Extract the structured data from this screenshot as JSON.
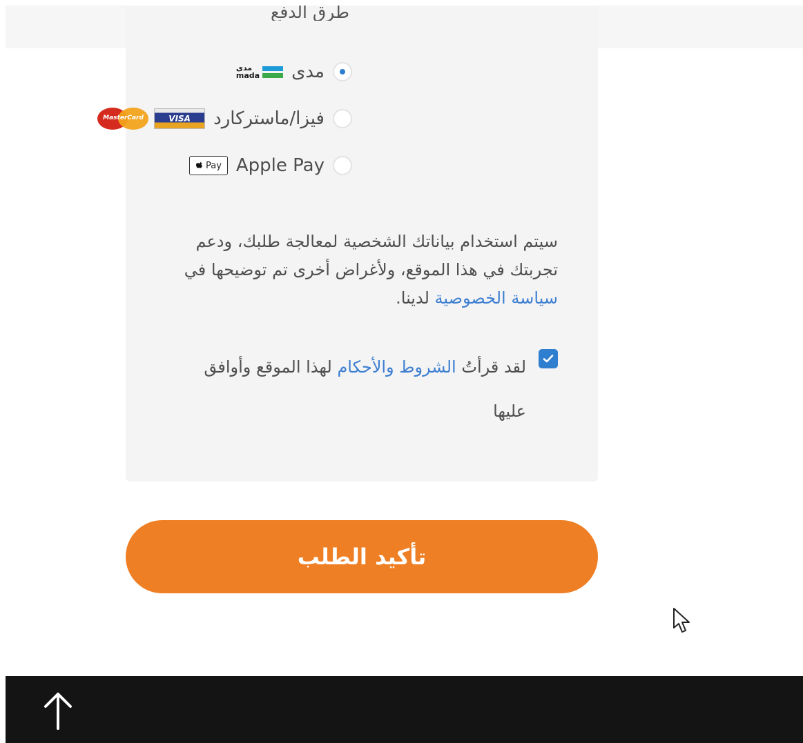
{
  "payment": {
    "section_title": "طرق الدفع",
    "options": [
      {
        "label": "مدى",
        "logo_text_ar": "مدى",
        "logo_text_en": "mada",
        "selected": true
      },
      {
        "label": "فيزا/ماستركارد",
        "visa_text": "VISA",
        "mastercard_text": "MasterCard",
        "selected": false
      },
      {
        "label": "Apple Pay",
        "badge_text": "Pay",
        "selected": false
      }
    ]
  },
  "privacy": {
    "text_before": "سيتم استخدام بياناتك الشخصية لمعالجة طلبك، ودعم تجربتك في هذا الموقع، ولأغراض أخرى تم توضيحها في",
    "link": "سياسة الخصوصية",
    "text_after": "لدينا."
  },
  "terms": {
    "checked": true,
    "text_before": "لقد قرأتُ",
    "link": "الشروط والأحكام",
    "text_after": "لهذا الموقع وأوافق عليها"
  },
  "confirm_button": {
    "label": "تأكيد الطلب"
  },
  "colors": {
    "accent_orange": "#ef7f25",
    "link_blue": "#3e7fd1",
    "checkbox_blue": "#2f7fd0",
    "footer_bg": "#141414",
    "panel_bg": "#f4f4f5"
  },
  "icons": {
    "cursor": "mouse-pointer-icon",
    "back_to_top": "arrow-up-icon"
  }
}
